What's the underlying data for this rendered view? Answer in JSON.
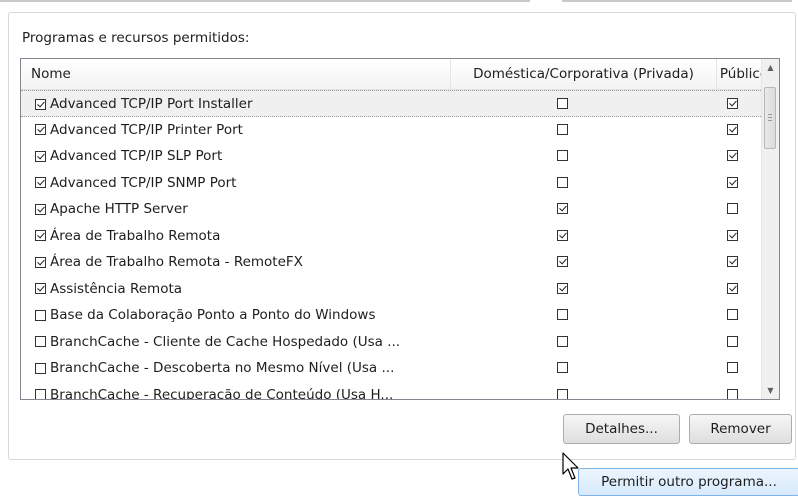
{
  "group": {
    "title": "Programas e recursos permitidos:"
  },
  "list": {
    "columns": {
      "name": "Nome",
      "private": "Doméstica/Corporativa (Privada)",
      "public": "Público"
    },
    "rows": [
      {
        "name": "Advanced TCP/IP Port Installer",
        "enabled": true,
        "private": false,
        "public": true,
        "selected": true
      },
      {
        "name": "Advanced TCP/IP Printer Port",
        "enabled": true,
        "private": false,
        "public": true
      },
      {
        "name": "Advanced TCP/IP SLP Port",
        "enabled": true,
        "private": false,
        "public": true
      },
      {
        "name": "Advanced TCP/IP SNMP Port",
        "enabled": true,
        "private": false,
        "public": true
      },
      {
        "name": "Apache HTTP Server",
        "enabled": true,
        "private": true,
        "public": false
      },
      {
        "name": "Área de Trabalho Remota",
        "enabled": true,
        "private": true,
        "public": true
      },
      {
        "name": "Área de Trabalho Remota - RemoteFX",
        "enabled": true,
        "private": true,
        "public": true
      },
      {
        "name": "Assistência Remota",
        "enabled": true,
        "private": true,
        "public": true
      },
      {
        "name": "Base da Colaboração Ponto a Ponto do Windows",
        "enabled": false,
        "private": false,
        "public": false
      },
      {
        "name": "BranchCache - Cliente de Cache Hospedado (Usa ...",
        "enabled": false,
        "private": false,
        "public": false
      },
      {
        "name": "BranchCache - Descoberta no Mesmo Nível (Usa ...",
        "enabled": false,
        "private": false,
        "public": false
      },
      {
        "name": "BranchCache - Recuperação de Conteúdo (Usa H...",
        "enabled": false,
        "private": false,
        "public": false
      }
    ]
  },
  "buttons": {
    "details": "Detalhes...",
    "remove": "Remover",
    "allow_other": "Permitir outro programa..."
  },
  "icons": {
    "scroll_up": "up-arrow-icon",
    "scroll_down": "down-arrow-icon",
    "cursor": "mouse-pointer-icon"
  }
}
